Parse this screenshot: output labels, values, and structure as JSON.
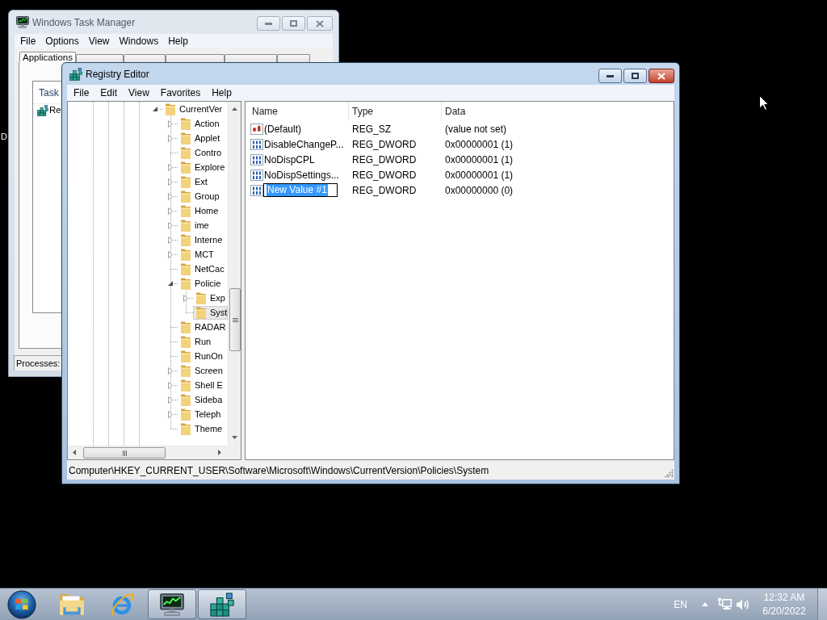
{
  "desktop": {
    "icon_label": "D"
  },
  "task_manager": {
    "title": "Windows Task Manager",
    "active": false,
    "menu": [
      "File",
      "Options",
      "View",
      "Windows",
      "Help"
    ],
    "tabs": [
      {
        "label": "Applications",
        "selected": true
      },
      {
        "selected": false
      },
      {
        "selected": false
      },
      {
        "selected": false
      },
      {
        "selected": false
      },
      {
        "selected": false
      }
    ],
    "task_list": {
      "columns": [
        "Task"
      ],
      "rows": [
        {
          "task": "Re"
        }
      ]
    },
    "status_bar": "Processes:"
  },
  "registry_editor": {
    "title": "Registry Editor",
    "active": true,
    "menu": [
      "File",
      "Edit",
      "View",
      "Favorites",
      "Help"
    ],
    "tree": {
      "label": "CurrentVer",
      "kind": "branch",
      "expanded": true,
      "selected": false,
      "children": [
        {
          "label": "Action",
          "kind": "branch",
          "expanded": false,
          "selected": false
        },
        {
          "label": "Applet",
          "kind": "branch",
          "expanded": false,
          "selected": false
        },
        {
          "label": "Contro",
          "kind": "leaf",
          "expanded": false,
          "selected": false
        },
        {
          "label": "Explore",
          "kind": "branch",
          "expanded": false,
          "selected": false
        },
        {
          "label": "Ext",
          "kind": "branch",
          "expanded": false,
          "selected": false
        },
        {
          "label": "Group",
          "kind": "branch",
          "expanded": false,
          "selected": false
        },
        {
          "label": "Home",
          "kind": "branch",
          "expanded": false,
          "selected": false
        },
        {
          "label": "ime",
          "kind": "branch",
          "expanded": false,
          "selected": false
        },
        {
          "label": "Interne",
          "kind": "branch",
          "expanded": false,
          "selected": false
        },
        {
          "label": "MCT",
          "kind": "branch",
          "expanded": false,
          "selected": false
        },
        {
          "label": "NetCac",
          "kind": "leaf",
          "expanded": false,
          "selected": false
        },
        {
          "label": "Policie",
          "kind": "branch",
          "expanded": true,
          "selected": false,
          "children": [
            {
              "label": "Exp",
              "kind": "branch",
              "expanded": false,
              "selected": false
            },
            {
              "label": "Syst",
              "kind": "leaf",
              "expanded": false,
              "selected": true
            }
          ]
        },
        {
          "label": "RADAR",
          "kind": "leaf",
          "expanded": false,
          "selected": false
        },
        {
          "label": "Run",
          "kind": "leaf",
          "expanded": false,
          "selected": false
        },
        {
          "label": "RunOn",
          "kind": "leaf",
          "expanded": false,
          "selected": false
        },
        {
          "label": "Screen",
          "kind": "branch",
          "expanded": false,
          "selected": false
        },
        {
          "label": "Shell E",
          "kind": "branch",
          "expanded": false,
          "selected": false
        },
        {
          "label": "Sideba",
          "kind": "branch",
          "expanded": false,
          "selected": false
        },
        {
          "label": "Teleph",
          "kind": "branch",
          "expanded": false,
          "selected": false
        },
        {
          "label": "Theme",
          "kind": "leaf",
          "expanded": false,
          "selected": false
        }
      ]
    },
    "values": {
      "columns": [
        "Name",
        "Type",
        "Data"
      ],
      "rows": [
        {
          "kind": "string",
          "name": "(Default)",
          "type": "REG_SZ",
          "data": "(value not set)",
          "editing": false
        },
        {
          "kind": "dword",
          "name": "DisableChangeP...",
          "type": "REG_DWORD",
          "data": "0x00000001 (1)",
          "editing": false
        },
        {
          "kind": "dword",
          "name": "NoDispCPL",
          "type": "REG_DWORD",
          "data": "0x00000001 (1)",
          "editing": false
        },
        {
          "kind": "dword",
          "name": "NoDispSettings...",
          "type": "REG_DWORD",
          "data": "0x00000001 (1)",
          "editing": false
        },
        {
          "kind": "dword",
          "name": "New Value #1",
          "type": "REG_DWORD",
          "data": "0x00000000 (0)",
          "editing": true
        }
      ]
    },
    "status_bar": "Computer\\HKEY_CURRENT_USER\\Software\\Microsoft\\Windows\\CurrentVersion\\Policies\\System"
  },
  "taskbar": {
    "buttons": [
      {
        "kind": "folder",
        "running": false
      },
      {
        "kind": "browser",
        "running": false
      },
      {
        "kind": "task_manager",
        "running": true
      },
      {
        "kind": "registry",
        "running": true
      }
    ],
    "tray": {
      "language": "EN",
      "time": "12:32 AM",
      "date": "6/20/2022"
    }
  }
}
